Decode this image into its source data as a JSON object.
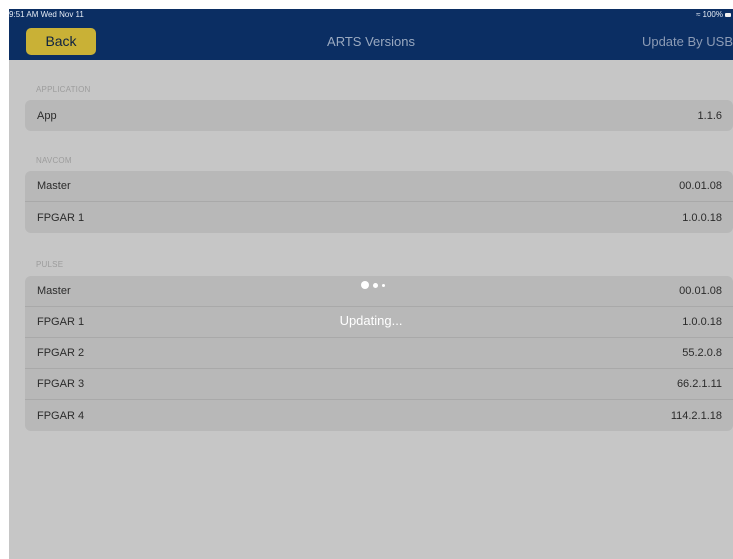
{
  "status_bar": {
    "time_date": "9:51 AM  Wed Nov 11",
    "battery": "100%",
    "wifi_icon": "wifi-icon",
    "battery_icon": "battery-icon"
  },
  "nav": {
    "back_label": "Back",
    "title": "ARTS Versions",
    "right_label": "Update By USB"
  },
  "sections": {
    "application": {
      "header": "APPLICATION",
      "rows": [
        {
          "label": "App",
          "value": "1.1.6"
        }
      ]
    },
    "navcom": {
      "header": "NAVCOM",
      "rows": [
        {
          "label": "Master",
          "value": "00.01.08"
        },
        {
          "label": "FPGAR 1",
          "value": "1.0.0.18"
        }
      ]
    },
    "pulse": {
      "header": "PULSE",
      "rows": [
        {
          "label": "Master",
          "value": "00.01.08"
        },
        {
          "label": "FPGAR 1",
          "value": "1.0.0.18"
        },
        {
          "label": "FPGAR 2",
          "value": "55.2.0.8"
        },
        {
          "label": "FPGAR 3",
          "value": "66.2.1.11"
        },
        {
          "label": "FPGAR 4",
          "value": "114.2.1.18"
        }
      ]
    }
  },
  "overlay": {
    "status_text": "Updating..."
  },
  "colors": {
    "nav_background": "#0b2e63",
    "back_button": "#c9b136",
    "dimmed_background": "#c6c6c6"
  }
}
